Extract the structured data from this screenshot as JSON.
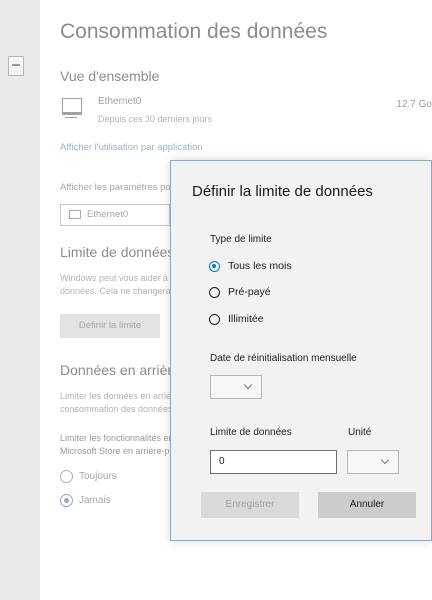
{
  "settings": {
    "page_title": "Consommation des données",
    "overview_heading": "Vue d'ensemble",
    "network": {
      "name": "Ethernet0",
      "period": "Depuis ces 30 derniers jours",
      "usage": "12.7 Go"
    },
    "usage_link": "Afficher l'utilisation par application",
    "show_settings_label": "Afficher les paramètres pour",
    "network_select_value": "Ethernet0",
    "limit_heading": "Limite de données",
    "limit_description": [
      "Windows peut vous aider à limiter votre consommation de",
      "données. Cela ne changera pas la limite de votre forfait"
    ],
    "set_limit_button": "Définir la limite",
    "background_heading": "Données en arrière-plan",
    "background_description": [
      "Limiter les données en arrière-plan réduit la",
      "consommation des données"
    ],
    "limit_functions_text": [
      "Limiter les fonctionnalités en arrière-plan de",
      "Microsoft Store en arrière-plan"
    ],
    "background_options": [
      "Toujours",
      "Jamais"
    ],
    "background_selected": "Jamais"
  },
  "dialog": {
    "title": "Définir la limite de données",
    "limit_type_label": "Type de limite",
    "options": [
      "Tous les mois",
      "Pré-payé",
      "Illimitée"
    ],
    "selected_option": "Tous les mois",
    "reset_date_label": "Date de réinitialisation mensuelle",
    "reset_date_value": "",
    "data_limit_label": "Limite de données",
    "unit_label": "Unité",
    "data_limit_value": "0",
    "unit_value": "",
    "save_button": "Enregistrer",
    "cancel_button": "Annuler"
  },
  "colors": {
    "accent": "#0078d7",
    "dialog_border": "#8aa8cf",
    "link": "#9bb2cf"
  }
}
